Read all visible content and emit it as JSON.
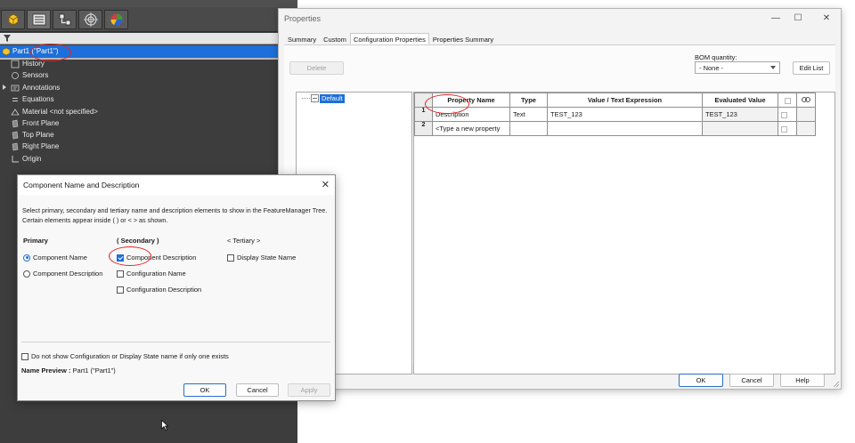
{
  "feature_manager": {
    "tabs": [
      "featuremanager-tab",
      "propertymanager-tab",
      "configurationmanager-tab",
      "dimxpert-tab",
      "display-tab"
    ],
    "root_label": "Part1 (\"Part1\")",
    "items": [
      {
        "label": "History",
        "icon": "history-icon"
      },
      {
        "label": "Sensors",
        "icon": "sensors-icon"
      },
      {
        "label": "Annotations",
        "icon": "annotations-icon"
      },
      {
        "label": "Equations",
        "icon": "equations-icon"
      },
      {
        "label": "Material <not specified>",
        "icon": "material-icon"
      },
      {
        "label": "Front Plane",
        "icon": "plane-icon"
      },
      {
        "label": "Top Plane",
        "icon": "plane-icon"
      },
      {
        "label": "Right Plane",
        "icon": "plane-icon"
      },
      {
        "label": "Origin",
        "icon": "origin-icon"
      }
    ]
  },
  "properties": {
    "title": "Properties",
    "tabs": [
      "Summary",
      "Custom",
      "Configuration Properties",
      "Properties Summary"
    ],
    "active_tab": "Configuration Properties",
    "delete_label": "Delete",
    "bom_label": "BOM quantity:",
    "bom_value": "- None -",
    "edit_list_label": "Edit List",
    "config_name": "Default",
    "columns": [
      "Property Name",
      "Type",
      "Value / Text Expression",
      "Evaluated Value"
    ],
    "rows": [
      {
        "num": "1",
        "name": "Description",
        "type": "Text",
        "value": "TEST_123",
        "evaluated": "TEST_123"
      },
      {
        "num": "2",
        "name": "<Type a new property",
        "type": "",
        "value": "",
        "evaluated": ""
      }
    ],
    "ok_label": "OK",
    "cancel_label": "Cancel",
    "help_label": "Help"
  },
  "dialog": {
    "title": "Component Name and Description",
    "description": "Select primary, secondary and tertiary name and description elements to show in the FeatureManager Tree. Certain elements appear inside ( ) or < > as shown.",
    "primary_head": "Primary",
    "secondary_head": "( Secondary )",
    "tertiary_head": "< Tertiary >",
    "primary_opts": [
      "Component Name",
      "Component Description"
    ],
    "secondary_opts": [
      "Component Description",
      "Configuration Name",
      "Configuration Description"
    ],
    "tertiary_opts": [
      "Display State Name"
    ],
    "dont_show_label": "Do not show Configuration or Display State name if only one exists",
    "preview_label": "Name Preview :",
    "preview_value": "Part1 (\"Part1\")",
    "ok_label": "OK",
    "cancel_label": "Cancel",
    "apply_label": "Apply"
  },
  "colors": {
    "accent": "#1e6fd9",
    "highlight": "#e0242a",
    "featuremanager_bg": "#3d3d3d"
  }
}
